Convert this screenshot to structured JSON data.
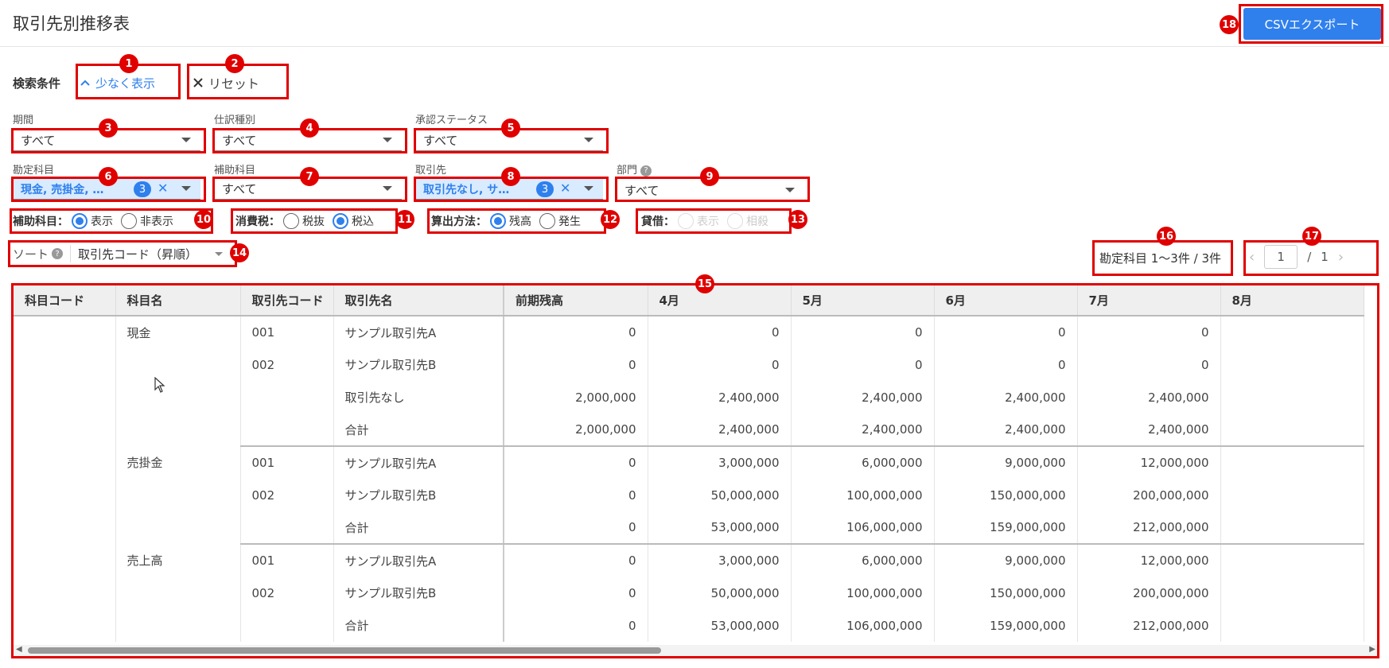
{
  "header": {
    "title": "取引先別推移表",
    "csv_button": "CSVエクスポート"
  },
  "search": {
    "label": "検索条件",
    "less_button": "少なく表示",
    "reset_button": "リセット"
  },
  "filters": {
    "period": {
      "label": "期間",
      "value": "すべて"
    },
    "journal_type": {
      "label": "仕訳種別",
      "value": "すべて"
    },
    "approval_status": {
      "label": "承認ステータス",
      "value": "すべて"
    },
    "account": {
      "label": "勘定科目",
      "value": "現金, 売掛金, …",
      "count": "3"
    },
    "sub_account": {
      "label": "補助科目",
      "value": "すべて"
    },
    "partner": {
      "label": "取引先",
      "value": "取引先なし, サ…",
      "count": "3"
    },
    "department": {
      "label": "部門",
      "value": "すべて",
      "help": "?"
    }
  },
  "radios": {
    "sub_account_display": {
      "label": "補助科目：",
      "options": [
        "表示",
        "非表示"
      ],
      "selected": "表示"
    },
    "tax": {
      "label": "消費税：",
      "options": [
        "税抜",
        "税込"
      ],
      "selected": "税込"
    },
    "calc": {
      "label": "算出方法：",
      "options": [
        "残高",
        "発生"
      ],
      "selected": "残高"
    },
    "debit_credit": {
      "label": "貸借：",
      "options": [
        "表示",
        "相殺"
      ],
      "selected": ""
    }
  },
  "sort": {
    "label": "ソート",
    "help": "?",
    "value": "取引先コード（昇順）"
  },
  "count_text": "勘定科目 1〜3件 / 3件",
  "pager": {
    "current": "1",
    "separator": "/",
    "total": "1",
    "prev": "‹",
    "next": "›"
  },
  "table": {
    "columns": [
      "科目コード",
      "科目名",
      "取引先コード",
      "取引先名",
      "前期残高",
      "4月",
      "5月",
      "6月",
      "7月",
      "8月"
    ],
    "groups": [
      {
        "account": "現金",
        "rows": [
          {
            "code": "001",
            "name": "サンプル取引先A",
            "values": [
              "0",
              "0",
              "0",
              "0",
              "0"
            ]
          },
          {
            "code": "002",
            "name": "サンプル取引先B",
            "values": [
              "0",
              "0",
              "0",
              "0",
              "0"
            ]
          },
          {
            "code": "",
            "name": "取引先なし",
            "values": [
              "2,000,000",
              "2,400,000",
              "2,400,000",
              "2,400,000",
              "2,400,000"
            ]
          },
          {
            "code": "",
            "name": "合計",
            "values": [
              "2,000,000",
              "2,400,000",
              "2,400,000",
              "2,400,000",
              "2,400,000"
            ]
          }
        ]
      },
      {
        "account": "売掛金",
        "rows": [
          {
            "code": "001",
            "name": "サンプル取引先A",
            "values": [
              "0",
              "3,000,000",
              "6,000,000",
              "9,000,000",
              "12,000,000"
            ]
          },
          {
            "code": "002",
            "name": "サンプル取引先B",
            "values": [
              "0",
              "50,000,000",
              "100,000,000",
              "150,000,000",
              "200,000,000"
            ]
          },
          {
            "code": "",
            "name": "合計",
            "values": [
              "0",
              "53,000,000",
              "106,000,000",
              "159,000,000",
              "212,000,000"
            ]
          }
        ]
      },
      {
        "account": "売上高",
        "rows": [
          {
            "code": "001",
            "name": "サンプル取引先A",
            "values": [
              "0",
              "3,000,000",
              "6,000,000",
              "9,000,000",
              "12,000,000"
            ]
          },
          {
            "code": "002",
            "name": "サンプル取引先B",
            "values": [
              "0",
              "50,000,000",
              "100,000,000",
              "150,000,000",
              "200,000,000"
            ]
          },
          {
            "code": "",
            "name": "合計",
            "values": [
              "0",
              "53,000,000",
              "106,000,000",
              "159,000,000",
              "212,000,000"
            ]
          }
        ]
      }
    ]
  },
  "annotations": [
    "1",
    "2",
    "3",
    "4",
    "5",
    "6",
    "7",
    "8",
    "9",
    "10",
    "11",
    "12",
    "13",
    "14",
    "15",
    "16",
    "17",
    "18"
  ],
  "colors": {
    "accent": "#2f80ed",
    "annotation": "#e00000",
    "chip_bg": "#d8ebff"
  }
}
